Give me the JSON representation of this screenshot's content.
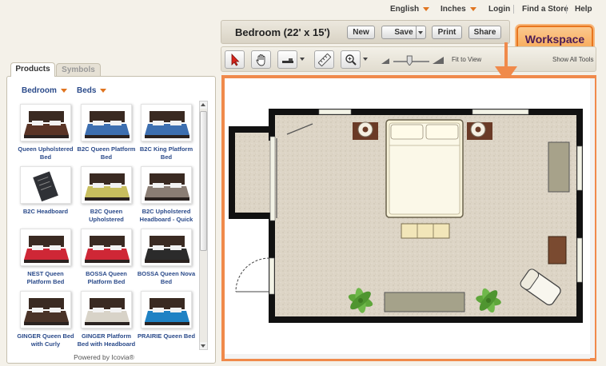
{
  "topbar": {
    "language": "English",
    "units": "Inches",
    "login": "Login",
    "find_store": "Find a Store",
    "help": "Help"
  },
  "titlebar": {
    "room_title": "Bedroom (22' x 15')",
    "new_label": "New",
    "save_label": "Save",
    "print_label": "Print",
    "share_label": "Share"
  },
  "workspace_label": "Workspace",
  "toolbar": {
    "fit_label": "Fit to View",
    "show_all": "Show All Tools",
    "tool_icons": [
      "pointer-icon",
      "hand-icon",
      "wall-tool-icon",
      "ruler-icon",
      "zoom-icon"
    ],
    "zoom_level": 0.45
  },
  "panel": {
    "tabs": [
      "Products",
      "Symbols"
    ],
    "filter_category": "Bedroom",
    "filter_type": "Beds",
    "products": [
      {
        "name": "Queen Upholstered Bed",
        "color": "#5a3426"
      },
      {
        "name": "B2C Queen Platform Bed",
        "color": "#3d6fb0"
      },
      {
        "name": "B2C King Platform Bed",
        "color": "#3d6fb0"
      },
      {
        "name": "B2C Headboard",
        "color": "#2f3136"
      },
      {
        "name": "B2C Queen Upholstered",
        "color": "#c8be5e"
      },
      {
        "name": "B2C Upholstered Headboard - Quick",
        "color": "#8a7d74"
      },
      {
        "name": "NEST Queen Platform Bed",
        "color": "#cf2736"
      },
      {
        "name": "BOSSA Queen Platform Bed",
        "color": "#cf2736"
      },
      {
        "name": "BOSSA Queen Nova Bed",
        "color": "#2b2b2b"
      },
      {
        "name": "GINGER Queen Bed with Curly",
        "color": "#4a3328"
      },
      {
        "name": "GINGER Platform Bed with Headboard",
        "color": "#d8d3c8"
      },
      {
        "name": "PRAIRIE Queen Bed",
        "color": "#1f82c4"
      }
    ],
    "powered_by": "Powered by Icovia®"
  },
  "colors": {
    "accent": "#f08a4b",
    "link": "#2a4a8a",
    "workspace_text": "#4b1a55"
  }
}
